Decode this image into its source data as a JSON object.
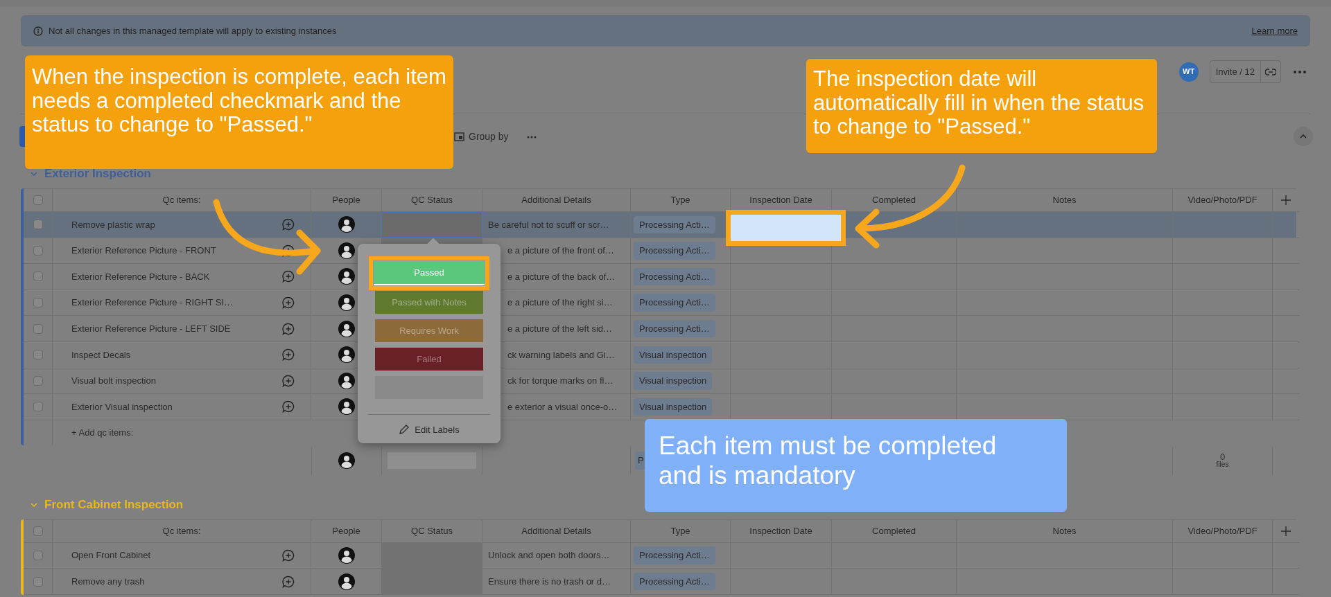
{
  "banner": {
    "text": "Not all changes in this managed template will apply to existing instances",
    "link": "Learn more"
  },
  "header": {
    "avatar": "WT",
    "invite": "Invite / 12"
  },
  "toolbar": {
    "group_by": "Group by"
  },
  "groups": [
    {
      "title": "Exterior Inspection",
      "color": "#3f5f9a",
      "all_checked": false,
      "columns": [
        "Qc items:",
        "People",
        "QC Status",
        "Additional Details",
        "Type",
        "Inspection Date",
        "Completed",
        "Notes",
        "Video/Photo/PDF"
      ],
      "rows": [
        {
          "name": "Remove plastic wrap",
          "details": "Be careful not to scuff or scr…",
          "type": "Processing Acti…",
          "selected": true,
          "checked": false
        },
        {
          "name": "Exterior Reference Picture - FRONT",
          "details": "e a picture of the front of…",
          "type": "Processing Acti…",
          "selected": false,
          "checked": false
        },
        {
          "name": "Exterior Reference Picture - BACK",
          "details": "e a picture of the back of…",
          "type": "Processing Acti…",
          "selected": false,
          "checked": false
        },
        {
          "name": "Exterior Reference Picture - RIGHT SI…",
          "details": "e a picture of the right si…",
          "type": "Processing Acti…",
          "selected": false,
          "checked": false
        },
        {
          "name": "Exterior Reference Picture - LEFT SIDE",
          "details": "e a picture of the left sid…",
          "type": "Processing Acti…",
          "selected": false,
          "checked": false
        },
        {
          "name": "Inspect Decals",
          "details": "ck warning labels and Gi…",
          "type": "Visual inspection",
          "selected": false,
          "checked": false
        },
        {
          "name": "Visual bolt inspection",
          "details": "ck for torque marks on fl…",
          "type": "Visual inspection",
          "selected": false,
          "checked": false
        },
        {
          "name": "Exterior Visual inspection",
          "details": "e exterior a visual once-o…",
          "type": "Visual inspection",
          "selected": false,
          "checked": false
        }
      ],
      "add_row": "+ Add qc items:",
      "summary": {
        "type": "P",
        "files_count": "0",
        "files_label": "files"
      }
    },
    {
      "title": "Front Cabinet Inspection",
      "color": "#e8b81c",
      "all_checked": false,
      "columns": [
        "Qc items:",
        "People",
        "QC Status",
        "Additional Details",
        "Type",
        "Inspection Date",
        "Completed",
        "Notes",
        "Video/Photo/PDF"
      ],
      "rows": [
        {
          "name": "Open Front Cabinet",
          "details": "Unlock and open both doors…",
          "type": "Processing Acti…",
          "selected": false,
          "checked": false
        },
        {
          "name": "Remove any trash",
          "details": "Ensure there is no trash or d…",
          "type": "Processing Acti…",
          "selected": false,
          "checked": false
        }
      ]
    }
  ],
  "status_menu": {
    "options": [
      {
        "label": "Passed",
        "color": "#5bc77d",
        "highlighted": true
      },
      {
        "label": "Passed with Notes",
        "color": "#5f7a2f",
        "highlighted": false
      },
      {
        "label": "Requires Work",
        "color": "#8c6a39",
        "highlighted": false
      },
      {
        "label": "Failed",
        "color": "#6a2027",
        "highlighted": false
      },
      {
        "color": "#8a8a8a",
        "highlighted": false
      }
    ],
    "edit": "Edit Labels"
  },
  "callouts": [
    {
      "kind": "orange",
      "text": "When the inspection is complete, each item needs a completed checkmark and the status to change to \"Passed.\""
    },
    {
      "kind": "orange",
      "text": "The inspection date will automatically fill in when the status to change to \"Passed.\""
    },
    {
      "kind": "blue",
      "text": "Each item must be completed and is mandatory"
    }
  ]
}
